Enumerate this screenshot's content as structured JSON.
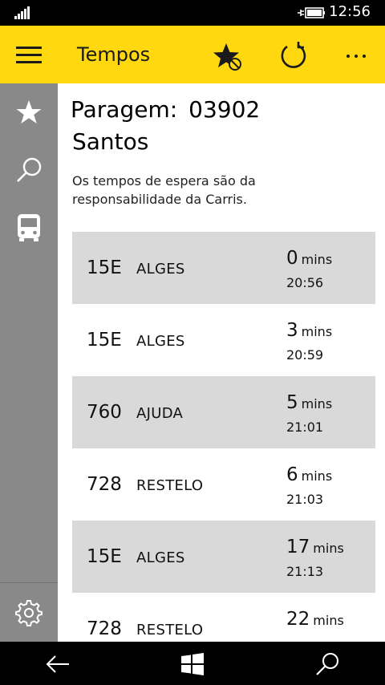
{
  "status_bar": {
    "time": "12:56",
    "icons": [
      "signal-icon",
      "battery-charging-icon"
    ]
  },
  "app_bar": {
    "title": "Tempos",
    "icons": [
      "hamburger-menu-icon",
      "favorite-star-icon",
      "refresh-icon",
      "more-icon"
    ]
  },
  "sidebar": {
    "icons": [
      "star-icon",
      "search-icon",
      "bus-icon",
      "settings-gear-icon"
    ]
  },
  "stop": {
    "label": "Paragem:",
    "code": "03902",
    "name": "Santos",
    "disclaimer": "Os tempos de espera são da responsabilidade da Carris."
  },
  "arrivals": [
    {
      "route": "15E",
      "destination": "ALGES",
      "minutes": "0",
      "unit": "mins",
      "time": "20:56"
    },
    {
      "route": "15E",
      "destination": "ALGES",
      "minutes": "3",
      "unit": "mins",
      "time": "20:59"
    },
    {
      "route": "760",
      "destination": "AJUDA",
      "minutes": "5",
      "unit": "mins",
      "time": "21:01"
    },
    {
      "route": "728",
      "destination": "RESTELO",
      "minutes": "6",
      "unit": "mins",
      "time": "21:03"
    },
    {
      "route": "15E",
      "destination": "ALGES",
      "minutes": "17",
      "unit": "mins",
      "time": "21:13"
    },
    {
      "route": "728",
      "destination": "RESTELO",
      "minutes": "22",
      "unit": "mins",
      "time": ""
    }
  ],
  "nav_bar": {
    "icons": [
      "back-arrow-icon",
      "windows-start-icon",
      "search-icon"
    ]
  },
  "colors": {
    "accent": "#FFD80F",
    "sidebar": "#898989",
    "row_shade": "#D9D9D9"
  }
}
